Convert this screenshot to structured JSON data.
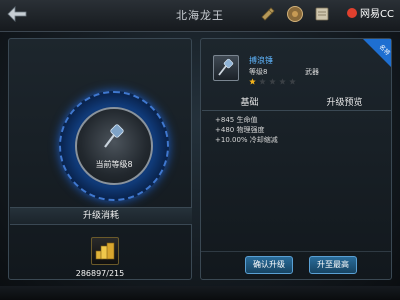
{
  "header": {
    "title": "北海龙王",
    "brand": "网易CC"
  },
  "left_panel": {
    "current_level_label": "当前等级8",
    "section_title": "升级消耗",
    "cost_text": "286897/215"
  },
  "item": {
    "name": "搏浪锤",
    "level": "等级8",
    "type": "武器",
    "stars_filled": 1,
    "stars_total": 5,
    "badge": "名将"
  },
  "tabs": [
    "基础",
    "升级预览"
  ],
  "stats": [
    "+845 生命值",
    "+480 物理强度",
    "+10.00% 冷却缩减"
  ],
  "buttons": {
    "confirm_upgrade": "确认升级",
    "upgrade_max": "升至最高"
  },
  "colors": {
    "accent_blue": "#1e6fd1",
    "item_name": "#5fb6ff",
    "star_gold": "#f2b21b",
    "brand_red": "#e0402e"
  }
}
